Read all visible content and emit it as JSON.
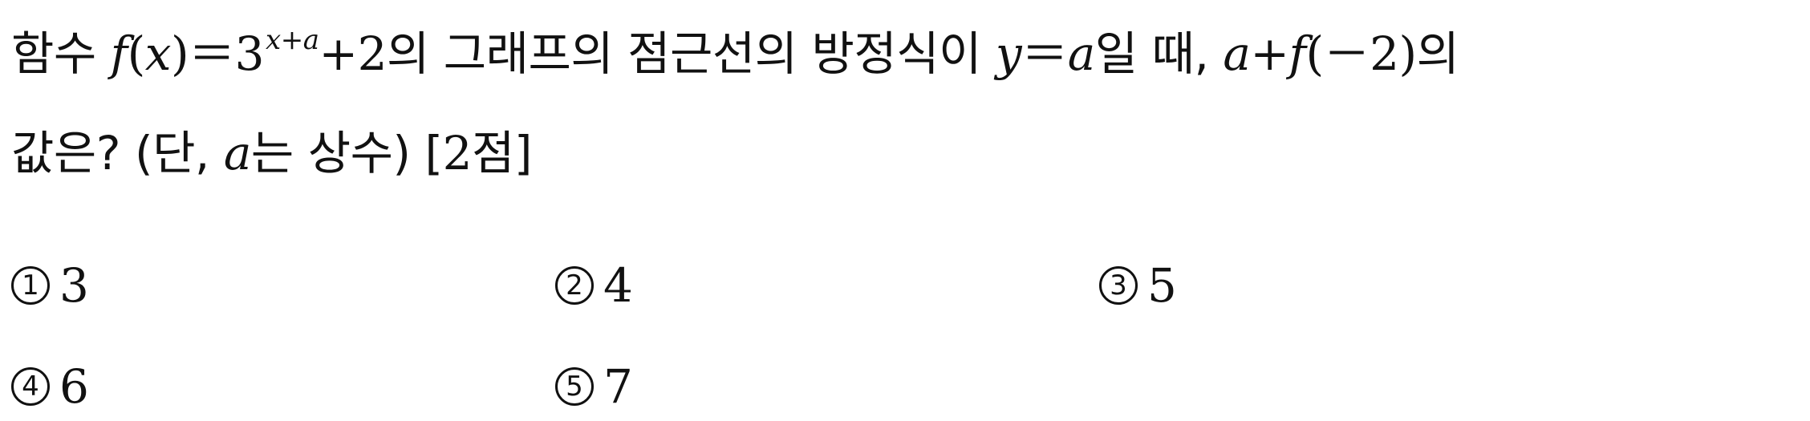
{
  "question": {
    "line1": {
      "t1": "함수 ",
      "m_f": "f",
      "m_open": "(",
      "m_x": "x",
      "m_close_eq": ")＝3",
      "sup": "x+a",
      "m_plus2": "+2",
      "t2": "의 그래프의 점근선의 방정식이 ",
      "m_y": "y",
      "m_eq": "＝",
      "m_a1": "a",
      "t3": "일 때, ",
      "m_a2": "a",
      "m_plus": "+",
      "m_f2": "f",
      "m_arg": "(－2)",
      "t4": "의"
    },
    "line2": {
      "t1": "값은? (단, ",
      "m_a": "a",
      "t2": "는 상수) [",
      "m_pts": "2",
      "t3": "점]"
    }
  },
  "choices": [
    {
      "marker": "1",
      "value": "3"
    },
    {
      "marker": "2",
      "value": "4"
    },
    {
      "marker": "3",
      "value": "5"
    },
    {
      "marker": "4",
      "value": "6"
    },
    {
      "marker": "5",
      "value": "7"
    }
  ]
}
